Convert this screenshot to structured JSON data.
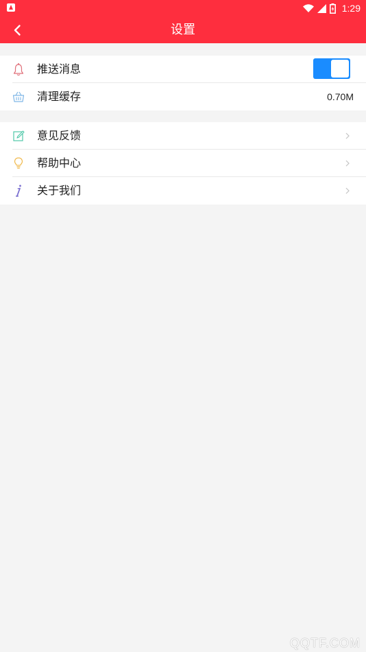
{
  "status_bar": {
    "time": "1:29",
    "icons": [
      "app-notification-icon",
      "wifi-icon",
      "cellular-signal-icon",
      "battery-charging-icon"
    ]
  },
  "app_bar": {
    "title": "设置",
    "back_icon": "chevron-left-icon"
  },
  "groups": [
    {
      "items": [
        {
          "label": "推送消息",
          "icon": "bell-icon",
          "control": "toggle",
          "toggle_on": true
        },
        {
          "label": "清理缓存",
          "icon": "basket-icon",
          "control": "value",
          "value": "0.70M"
        }
      ]
    },
    {
      "items": [
        {
          "label": "意见反馈",
          "icon": "edit-icon",
          "control": "chevron"
        },
        {
          "label": "帮助中心",
          "icon": "lightbulb-icon",
          "control": "chevron"
        },
        {
          "label": "关于我们",
          "icon": "info-icon",
          "control": "chevron"
        }
      ]
    }
  ],
  "colors": {
    "primary": "#fe2e3e",
    "toggle_on": "#1a8cff",
    "background": "#f4f4f4"
  },
  "watermark": "QQTF.COM"
}
